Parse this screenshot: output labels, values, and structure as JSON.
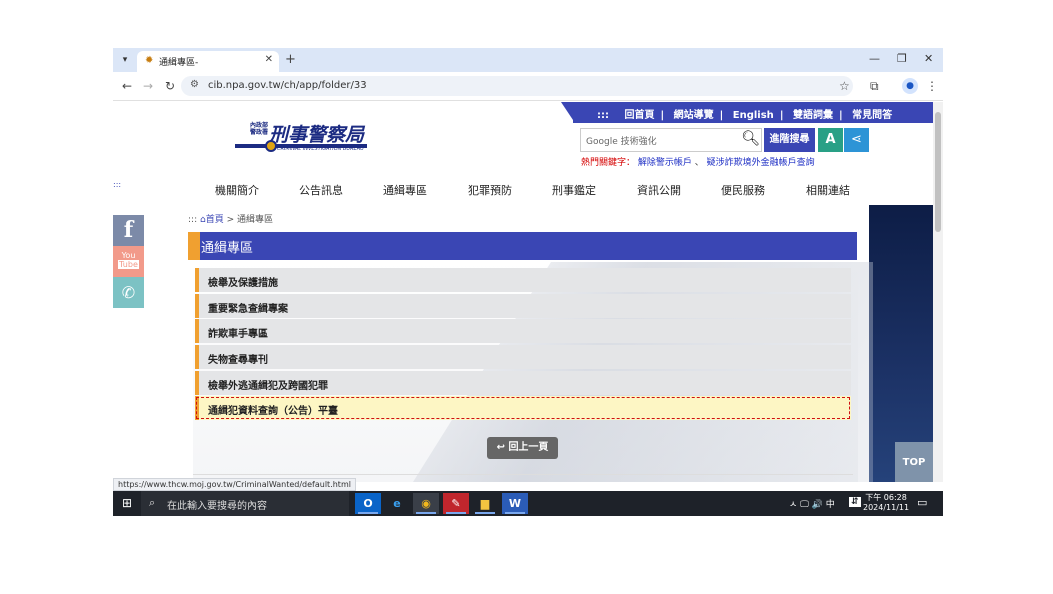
{
  "browser": {
    "tab_title": "通緝專區-",
    "url": "cib.npa.gov.tw/ch/app/folder/33",
    "status_url": "https://www.thcw.moj.gov.tw/CriminalWanted/default.html"
  },
  "header": {
    "top_links": [
      "回首頁",
      "網站導覽",
      "English",
      "雙語詞彙",
      "常見問答"
    ],
    "top_links_prefix": ":::",
    "logo_small": "內政部警政署",
    "logo_main": "刑事警察局",
    "logo_english": "CRIMINAL INVESTIGATION BUREAU",
    "search_placeholder": "Google 技術強化",
    "adv_search": "進階搜尋",
    "font_size_label": "A",
    "hotkeys_label": "熱門關鍵字：",
    "hotkeys": [
      "解除警示帳戶",
      "疑涉詐欺境外金融帳戶查詢"
    ],
    "hotkey_sep": "、"
  },
  "nav": [
    "機關簡介",
    "公告訊息",
    "通緝專區",
    "犯罪預防",
    "刑事鑑定",
    "資訊公開",
    "便民服務",
    "相關連結"
  ],
  "left_dots": ":::",
  "social": {
    "facebook": "f",
    "youtube_line1": "You",
    "youtube_line2": "Tube"
  },
  "breadcrumb": {
    "prefix": ":::",
    "home": "首頁",
    "sep": ">",
    "current": "通緝專區"
  },
  "section_title": "通緝專區",
  "list_items": [
    "檢舉及保護措施",
    "重要緊急查緝專案",
    "詐欺車手專區",
    "失物查尋專刊",
    "檢舉外逃通緝犯及跨國犯罪",
    "通緝犯資料查詢（公告）平臺"
  ],
  "back_button": "回上一頁",
  "top_button": "TOP",
  "taskbar": {
    "search_text": "在此輸入要搜尋的內容",
    "tray": "ㅅ 🖵 🔊 中",
    "time": "下午 06:28",
    "date": "2024/11/11"
  }
}
